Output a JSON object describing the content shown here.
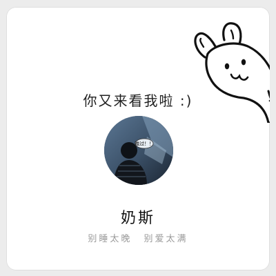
{
  "profile": {
    "greeting": "你又来看我啦 :)",
    "name": "奶斯",
    "motto": "别睡太晚  别爱太满"
  },
  "avatar": {
    "bubble_text": "难过！！",
    "icon": "avatar-photo"
  },
  "decor": {
    "icon": "bunny-icon"
  },
  "colors": {
    "card_bg": "#ffffff",
    "page_bg": "#ececec",
    "text": "#1f1f1f",
    "muted": "#9a9a9a"
  }
}
